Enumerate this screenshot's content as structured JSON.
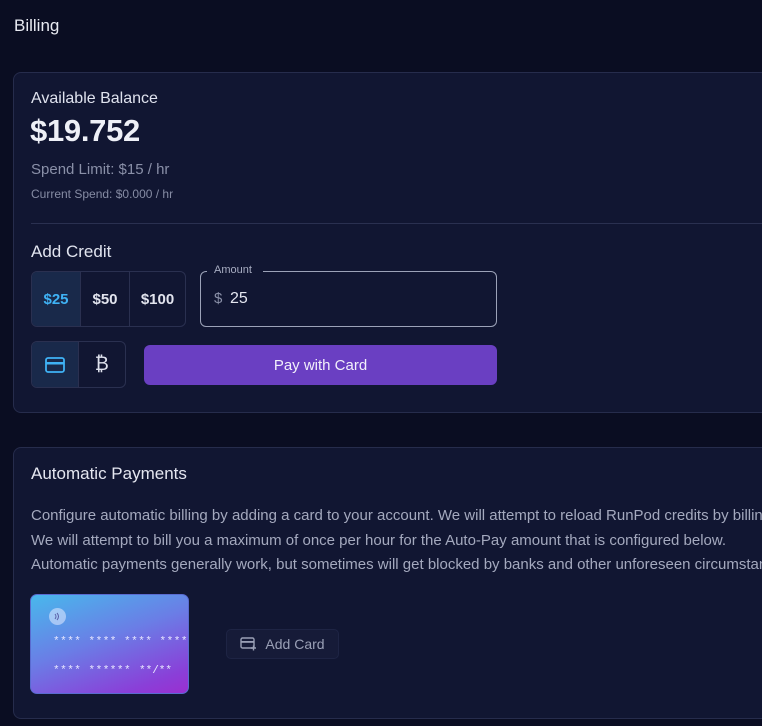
{
  "page": {
    "title": "Billing"
  },
  "balance": {
    "label": "Available Balance",
    "amount": "$19.752",
    "spend_limit": "Spend Limit: $15 / hr",
    "current_spend": "Current Spend: $0.000 / hr"
  },
  "add_credit": {
    "title": "Add Credit",
    "presets": [
      "$25",
      "$50",
      "$100"
    ],
    "selected_preset": "$25",
    "amount_label": "Amount",
    "currency_symbol": "$",
    "amount_value": "25",
    "payment_methods": [
      "card-icon",
      "bitcoin-icon"
    ],
    "selected_method": "card-icon",
    "pay_button": "Pay with Card"
  },
  "automatic_payments": {
    "title": "Automatic Payments",
    "description": [
      "Configure automatic billing by adding a card to your account. We will attempt to reload RunPod credits by billing",
      "We will attempt to bill you a maximum of once per hour for the Auto-Pay amount that is configured below.",
      "Automatic payments generally work, but sometimes will get blocked by banks and other unforeseen circumstances"
    ],
    "card": {
      "number_line1": "**** **** **** ****",
      "number_line2": "**** ******",
      "expiry": "**/**"
    },
    "add_card_button": "Add Card"
  },
  "colors": {
    "background": "#0a0d22",
    "panel": "#111632",
    "accent_blue": "#3fb2f5",
    "pay_button": "#6a3fc2"
  }
}
